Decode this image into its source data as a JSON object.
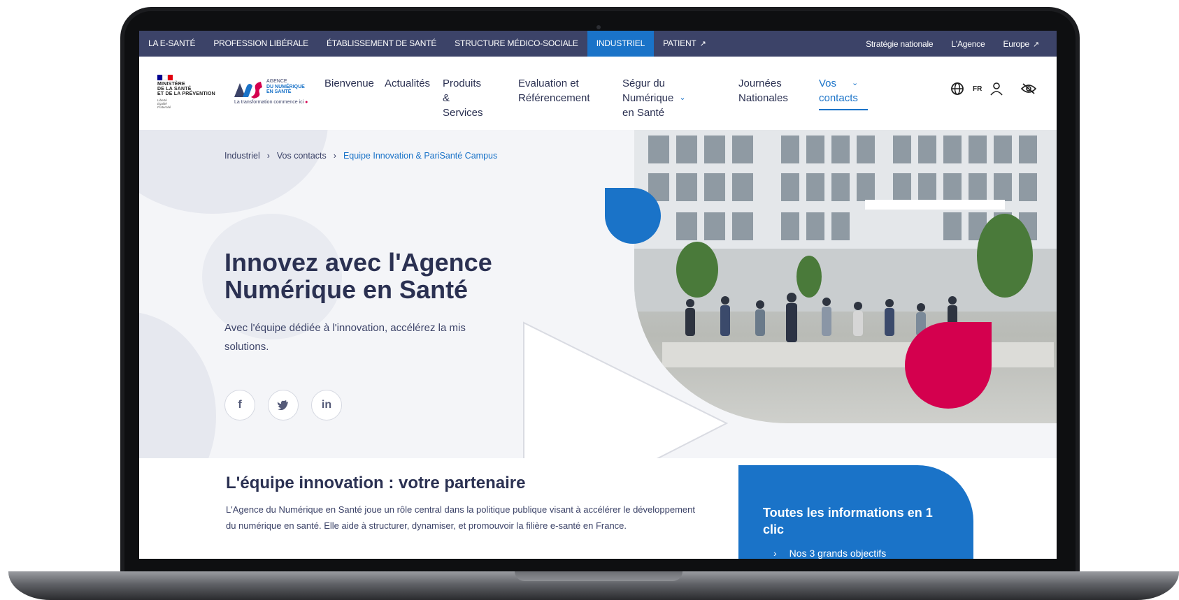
{
  "topbar": {
    "left_items": [
      "LA E-SANTÉ",
      "PROFESSION LIBÉRALE",
      "ÉTABLISSEMENT DE SANTÉ",
      "STRUCTURE MÉDICO-SOCIALE",
      "INDUSTRIEL",
      "PATIENT"
    ],
    "active_item": "INDUSTRIEL",
    "right_items": [
      "Stratégie nationale",
      "L'Agence",
      "Europe"
    ]
  },
  "header": {
    "ministry_lines": [
      "MINISTÈRE",
      "DE LA SANTÉ",
      "ET DE LA PRÉVENTION"
    ],
    "ministry_motto": [
      "Liberté",
      "Égalité",
      "Fraternité"
    ],
    "ans_lines": [
      "AGENCE",
      "DU NUMÉRIQUE",
      "EN SANTÉ"
    ],
    "ans_tagline": "La transformation commence ici",
    "nav": [
      {
        "label_l1": "Bienvenue",
        "label_l2": ""
      },
      {
        "label_l1": "Actualités",
        "label_l2": ""
      },
      {
        "label_l1": "Produits &",
        "label_l2": "Services"
      },
      {
        "label_l1": "Evaluation et",
        "label_l2": "Référencement"
      },
      {
        "label_l1": "Ségur du Numérique",
        "label_l2": "en Santé"
      },
      {
        "label_l1": "Journées",
        "label_l2": "Nationales"
      },
      {
        "label_l1": "Vos",
        "label_l2": "contacts"
      }
    ],
    "language": "FR"
  },
  "breadcrumb": {
    "items": [
      "Industriel",
      "Vos contacts",
      "Equipe Innovation & PariSanté Campus"
    ],
    "separator": "›"
  },
  "hero": {
    "title_l1": "Innovez avec l'Agence",
    "title_l2": "Numérique en Santé",
    "subtitle": "Avec l'équipe dédiée à l'innovation, accélérez la mise solutions.",
    "subtitle_l1": "Avec l'équipe dédiée à l'innovation, accélérez la mis",
    "subtitle_l2": "solutions.",
    "social": [
      "f",
      "t",
      "in"
    ]
  },
  "section": {
    "title": "L'équipe innovation : votre partenaire",
    "text": "L'Agence du Numérique en Santé joue un rôle central dans la politique publique visant à accélérer le développement du numérique en santé. Elle aide à structurer, dynamiser, et promouvoir la filière e-santé en France."
  },
  "info_card": {
    "title": "Toutes les informations en 1 clic",
    "item": "Nos 3 grands objectifs"
  },
  "colors": {
    "navy": "#3c4368",
    "blue": "#1a73c8",
    "red": "#d4004e",
    "text_dark": "#2b3152"
  }
}
